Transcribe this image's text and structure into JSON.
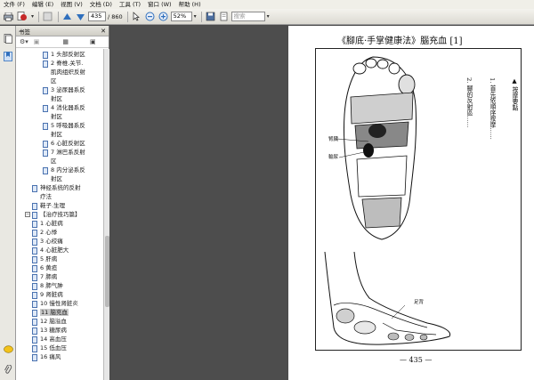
{
  "menu": [
    "文件 (F)",
    "编辑 (E)",
    "视图 (V)",
    "文档 (D)",
    "工具 (T)",
    "窗口 (W)",
    "帮助 (H)"
  ],
  "toolbar": {
    "page_current": "435",
    "page_total": "/ 860",
    "zoom": "52%",
    "search_placeholder": "搜索"
  },
  "panel": {
    "title": "书签"
  },
  "bookmarks": [
    {
      "label": "1 头部反射区",
      "level": 1
    },
    {
      "label": "2 脊椎.关节.",
      "level": 1
    },
    {
      "label": "肌肉组织反射",
      "level": 1,
      "cont": true
    },
    {
      "label": "区",
      "level": 1,
      "cont": true
    },
    {
      "label": "3 泌尿器系反",
      "level": 1
    },
    {
      "label": "射区",
      "level": 1,
      "cont": true
    },
    {
      "label": "4 消化器系反",
      "level": 1
    },
    {
      "label": "射区",
      "level": 1,
      "cont": true
    },
    {
      "label": "5 呼吸器系反",
      "level": 1
    },
    {
      "label": "射区",
      "level": 1,
      "cont": true
    },
    {
      "label": "6 心脏反射区",
      "level": 1
    },
    {
      "label": "7 淋巴系反射",
      "level": 1
    },
    {
      "label": "区",
      "level": 1,
      "cont": true
    },
    {
      "label": "8 内分泌系反",
      "level": 1
    },
    {
      "label": "射区",
      "level": 1,
      "cont": true
    },
    {
      "label": "神经系统的反射",
      "level": 0
    },
    {
      "label": "疗法",
      "level": 0,
      "cont": true
    },
    {
      "label": "鞋子.生理",
      "level": 0
    },
    {
      "label": "【治疗技巧篇】",
      "level": -1
    },
    {
      "label": "1 心脏病",
      "level": 0
    },
    {
      "label": "2 心悸",
      "level": 0
    },
    {
      "label": "3 心绞痛",
      "level": 0
    },
    {
      "label": "4 心脏肥大",
      "level": 0
    },
    {
      "label": "5 肝病",
      "level": 0
    },
    {
      "label": "6 黄疸",
      "level": 0
    },
    {
      "label": "7 肺病",
      "level": 0
    },
    {
      "label": "8 肺气肿",
      "level": 0
    },
    {
      "label": "9 肾脏病",
      "level": 0
    },
    {
      "label": "10 慢性肾脏炎",
      "level": 0
    },
    {
      "label": "11 脑充血",
      "level": 0,
      "selected": true
    },
    {
      "label": "12 脑溢血",
      "level": 0
    },
    {
      "label": "13 糖尿病",
      "level": 0
    },
    {
      "label": "14 高血压",
      "level": 0
    },
    {
      "label": "15 低血压",
      "level": 0
    },
    {
      "label": "16 痛风",
      "level": 0
    }
  ],
  "page": {
    "title": "《腳底·手掌健康法》腦充血 [1]",
    "page_number": "— 435 —",
    "label_kidney": "腎臟",
    "label_ureter": "輸尿",
    "label_foot": "足背",
    "col1": "▲ 按摩要點",
    "col2": "1. 首先依順序按摩……",
    "col3": "2. 腳的反射區……"
  },
  "colors": {
    "accent": "#2a5b9c",
    "selected_bg": "#c9c9c9",
    "doc_bg": "#4d4d4d"
  }
}
